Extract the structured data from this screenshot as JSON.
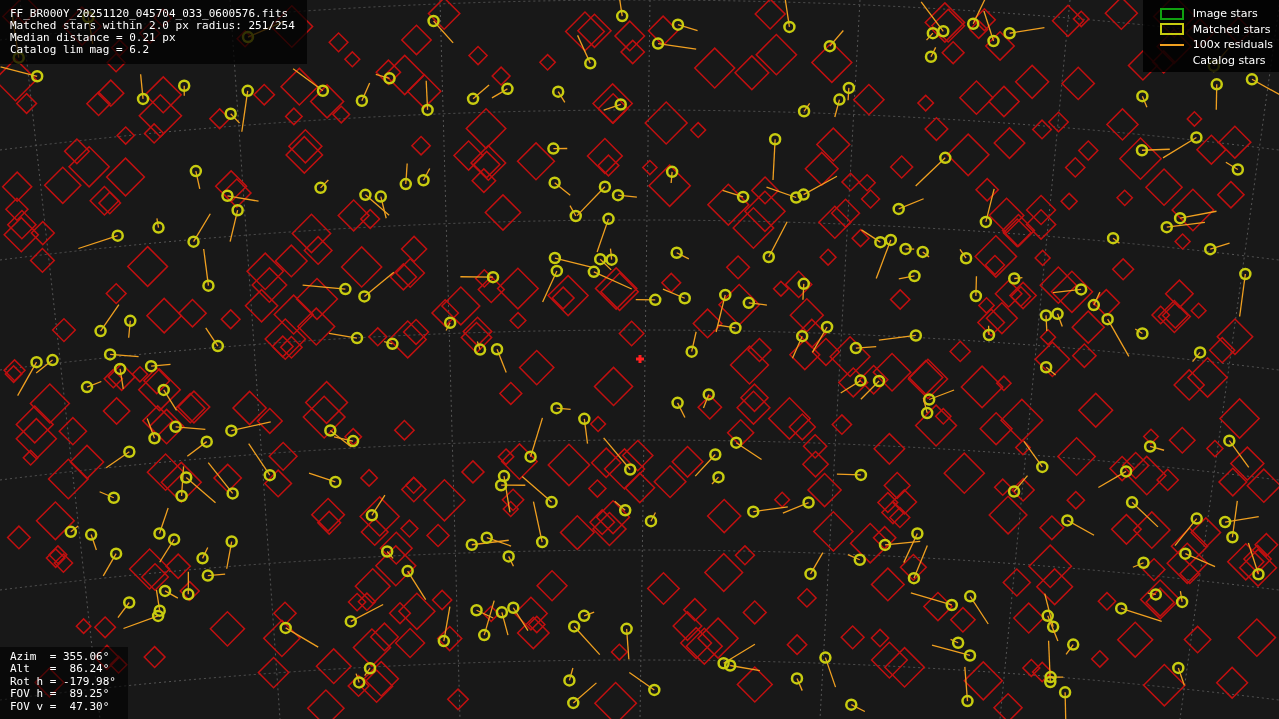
{
  "info": [
    "FF_BR000Y_20251120_045704_033_0600576.fits",
    "Matched stars within 2.0 px radius: 251/254",
    "Median distance = 0.21 px",
    "Catalog lim mag = 6.2"
  ],
  "legend": [
    {
      "kind": "image",
      "label": "Image stars"
    },
    {
      "kind": "matched",
      "label": "Matched stars"
    },
    {
      "kind": "residual",
      "label": "100x residuals"
    },
    {
      "kind": "catalog",
      "label": "Catalog stars"
    }
  ],
  "pointing": [
    "Azim  = 355.06°",
    "Alt   =  86.24°",
    "Rot h = -179.98°",
    "FOV h =  89.25°",
    "FOV v =  47.30°"
  ]
}
